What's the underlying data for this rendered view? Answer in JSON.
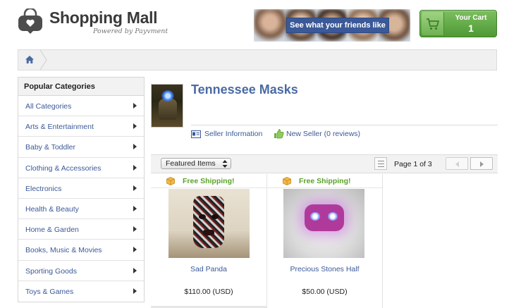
{
  "header": {
    "logo_title": "Shopping Mall",
    "logo_subtitle": "Powered by Payvment",
    "friends_button": "See what your friends like",
    "cart_label": "Your Cart",
    "cart_count": "1"
  },
  "colors": {
    "link_blue": "#3b5998",
    "title_blue": "#4a6aa3",
    "cart_green": "#5fa843",
    "shipping_green": "#59a22a"
  },
  "sidebar": {
    "title": "Popular Categories",
    "items": [
      {
        "label": "All Categories"
      },
      {
        "label": "Arts & Entertainment"
      },
      {
        "label": "Baby & Toddler"
      },
      {
        "label": "Clothing & Accessories"
      },
      {
        "label": "Electronics"
      },
      {
        "label": "Health & Beauty"
      },
      {
        "label": "Home & Garden"
      },
      {
        "label": "Books, Music & Movies"
      },
      {
        "label": "Sporting Goods"
      },
      {
        "label": "Toys & Games"
      }
    ]
  },
  "store": {
    "title": "Tennessee Masks",
    "seller_info": "Seller Information",
    "new_seller": "New Seller (0 reviews)"
  },
  "toolbar": {
    "sort_selected": "Featured Items",
    "page_text": "Page 1 of 3"
  },
  "products": [
    {
      "shipping": "Free Shipping!",
      "name": "Sad Panda",
      "price": "$110.00 (USD)"
    },
    {
      "shipping": "Free Shipping!",
      "name": "Precious Stones Half",
      "price": "$50.00 (USD)"
    }
  ]
}
